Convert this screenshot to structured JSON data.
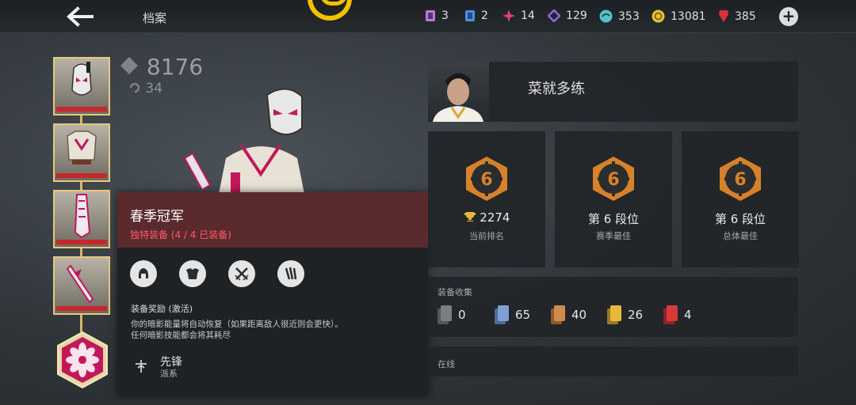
{
  "topbar": {
    "title": "档案",
    "currencies": [
      {
        "icon": "purple-ticket-icon",
        "color": "#b67ad8",
        "value": "3"
      },
      {
        "icon": "blue-card-icon",
        "color": "#4b8fe0",
        "value": "2"
      },
      {
        "icon": "pink-star-icon",
        "color": "#e0406a",
        "value": "14"
      },
      {
        "icon": "violet-diamond-icon",
        "color": "#8c6ad6",
        "value": "129"
      },
      {
        "icon": "teal-swirl-icon",
        "color": "#57c2c9",
        "value": "353"
      },
      {
        "icon": "gold-coin-icon",
        "color": "#e8c23a",
        "value": "13081"
      },
      {
        "icon": "red-gem-icon",
        "color": "#d8323a",
        "value": "385"
      }
    ]
  },
  "hero": {
    "power": "8176",
    "level": "34"
  },
  "set_popup": {
    "title": "春季冠军",
    "subtitle": "独特装备 (4 / 4 已装备)",
    "bonus_heading": "装备奖励 (激活)",
    "bonus_line1": "你的暗影能量将自动恢复（如果距离敌人很近则会更快）。",
    "bonus_line2": "任何暗影技能都会将其耗尽",
    "faction_name": "先锋",
    "faction_label": "派系"
  },
  "profile": {
    "player_name": "菜就多练"
  },
  "ranks": [
    {
      "tier": "6",
      "value": "2274",
      "label": "当前排名"
    },
    {
      "tier": "6",
      "value": "第 6 段位",
      "label": "赛季最佳"
    },
    {
      "tier": "6",
      "value": "第 6 段位",
      "label": "总体最佳"
    }
  ],
  "collection": {
    "heading": "装备收集",
    "counts": [
      {
        "color": "#7b7f84",
        "value": "0"
      },
      {
        "color": "#7f9ed2",
        "value": "65"
      },
      {
        "color": "#d08a4c",
        "value": "40"
      },
      {
        "color": "#e6b93a",
        "value": "26"
      },
      {
        "color": "#d8393b",
        "value": "4"
      }
    ]
  },
  "status": {
    "online_label": "在线"
  },
  "colors": {
    "accent_gold": "#f2c200",
    "rank_orange": "#d7822a",
    "popup_header": "#5a2a2c",
    "rarity_red": "#c8262d"
  }
}
